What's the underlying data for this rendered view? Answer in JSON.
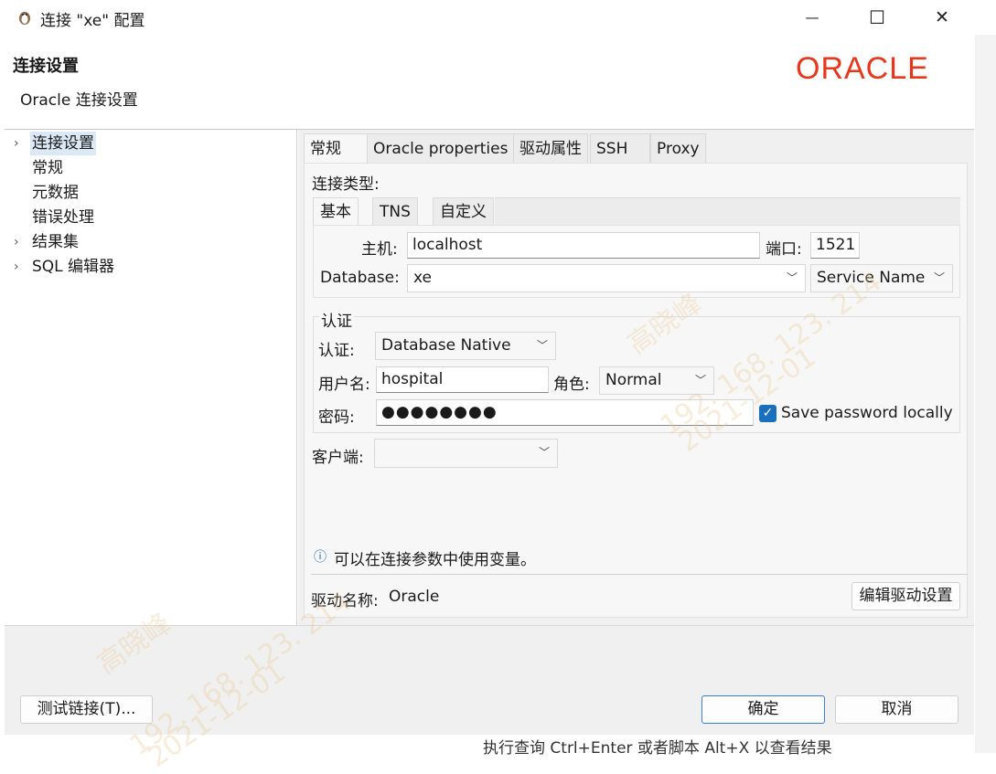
{
  "window": {
    "title": "连接 \"xe\" 配置",
    "minimize_glyph": "—",
    "maximize_glyph": "☐",
    "close_glyph": "✕"
  },
  "header": {
    "title": "连接设置",
    "subtitle": "Oracle 连接设置",
    "logo_text": "ORACLE",
    "logo_color": "#e8361a"
  },
  "tree": {
    "items": [
      {
        "label": "连接设置",
        "expandable": true,
        "selected": true
      },
      {
        "label": "常规",
        "expandable": false
      },
      {
        "label": "元数据",
        "expandable": false
      },
      {
        "label": "错误处理",
        "expandable": false
      },
      {
        "label": "结果集",
        "expandable": true
      },
      {
        "label": "SQL 编辑器",
        "expandable": true
      }
    ]
  },
  "tabs": [
    "常规",
    "Oracle properties",
    "驱动属性",
    "SSH",
    "Proxy"
  ],
  "general": {
    "connection_type_label": "连接类型:",
    "subtabs": [
      "基本",
      "TNS",
      "自定义"
    ],
    "host_label": "主机:",
    "host_value": "localhost",
    "port_label": "端口:",
    "port_value": "1521",
    "database_label": "Database:",
    "database_value": "xe",
    "service_type": "Service Name",
    "auth_group_label": "认证",
    "auth_label": "认证:",
    "auth_value": "Database Native",
    "username_label": "用户名:",
    "username_value": "hospital",
    "role_label": "角色:",
    "role_value": "Normal",
    "password_label": "密码:",
    "password_value": "●●●●●●●●",
    "save_password_label": "Save password locally",
    "save_password_checked": true,
    "client_label": "客户端:",
    "client_value": "",
    "info_text": "可以在连接参数中使用变量。",
    "driver_label": "驱动名称:",
    "driver_value": "Oracle",
    "edit_driver_button": "编辑驱动设置"
  },
  "footer": {
    "test_button": "测试链接(T)...",
    "ok_button": "确定",
    "cancel_button": "取消"
  },
  "background": {
    "status_text": "执行查询 Ctrl+Enter 或者脚本 Alt+X 以查看结果"
  },
  "watermark": {
    "name": "高晓峰",
    "ip": "192. 168. 123. 214",
    "date": "2021-12-01"
  }
}
